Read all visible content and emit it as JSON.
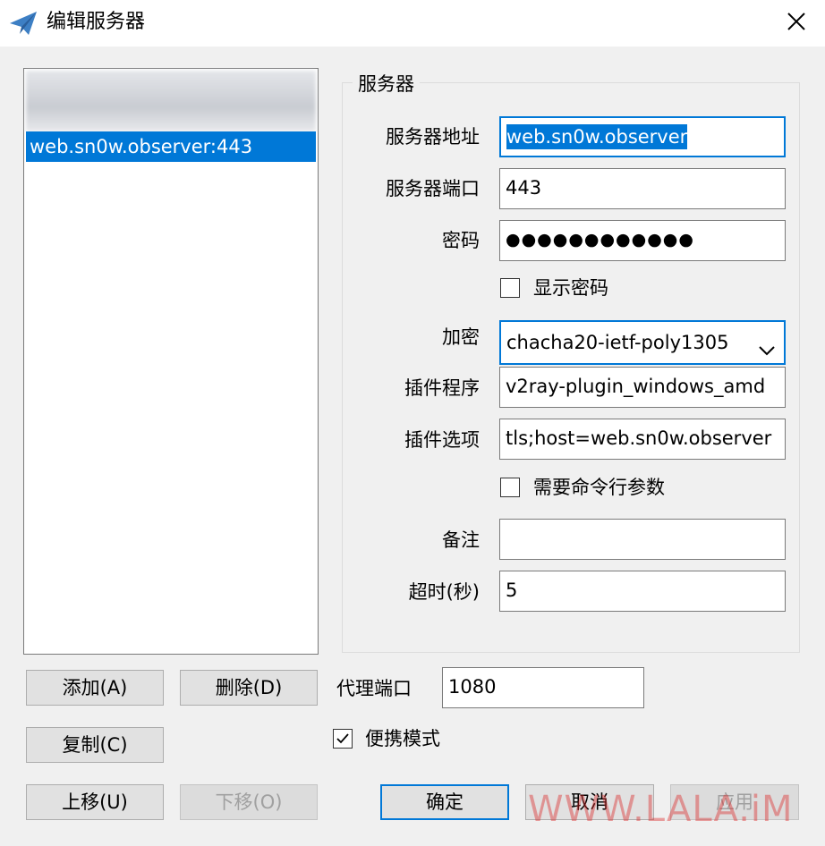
{
  "window": {
    "title": "编辑服务器",
    "icon": "paper-plane-icon",
    "close_icon": "close-icon"
  },
  "server_list": {
    "items": [
      {
        "label": "web.sn0w.observer:443",
        "selected": true
      }
    ]
  },
  "server_group": {
    "title": "服务器",
    "address_label": "服务器地址",
    "address_value": "web.sn0w.observer",
    "port_label": "服务器端口",
    "port_value": "443",
    "password_label": "密码",
    "password_value": "●●●●●●●●●●●●",
    "show_password_label": "显示密码",
    "show_password_checked": false,
    "encryption_label": "加密",
    "encryption_value": "chacha20-ietf-poly1305",
    "plugin_label": "插件程序",
    "plugin_value": "v2ray-plugin_windows_amd",
    "plugin_options_label": "插件选项",
    "plugin_options_value": "tls;host=web.sn0w.observer",
    "need_cmdline_label": "需要命令行参数",
    "need_cmdline_checked": false,
    "remarks_label": "备注",
    "remarks_value": "",
    "timeout_label": "超时(秒)",
    "timeout_value": "5"
  },
  "bottom": {
    "add_label": "添加(A)",
    "delete_label": "删除(D)",
    "copy_label": "复制(C)",
    "move_up_label": "上移(U)",
    "move_down_label": "下移(O)",
    "proxy_port_label": "代理端口",
    "proxy_port_value": "1080",
    "portable_label": "便携模式",
    "portable_checked": true,
    "ok_label": "确定",
    "cancel_label": "取消",
    "apply_label": "应用"
  },
  "watermark": "WWW.LALA.iM",
  "colors": {
    "accent": "#0078d7",
    "background": "#f0f0f0",
    "watermark": "#dc2828"
  }
}
